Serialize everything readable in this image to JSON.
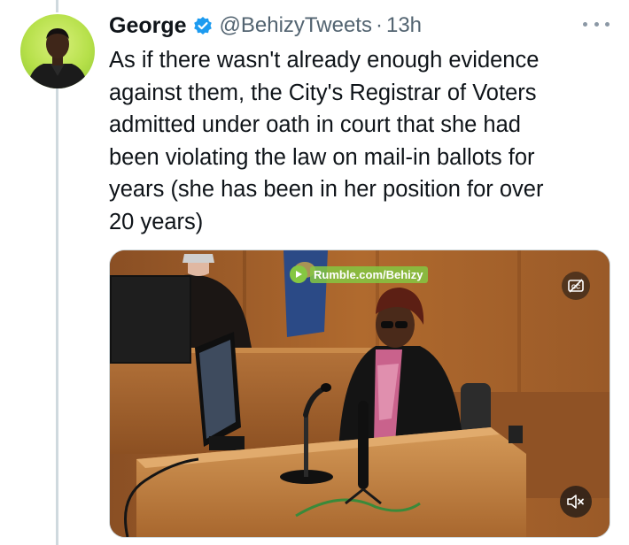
{
  "tweet": {
    "author": {
      "name": "George",
      "handle": "@BehizyTweets",
      "verified": true,
      "avatar": "profile-photo"
    },
    "separator": "·",
    "time": "13h",
    "more_icon": "more-horizontal-icon",
    "text_lines": [
      "As if there wasn't already enough evidence",
      "against them, the City's Registrar of Voters",
      "admitted under oath in court that she had",
      "been violating the law on mail-in ballots for",
      "years (she has been in her position for over",
      "20 years)"
    ],
    "media": {
      "type": "video",
      "watermark": "Rumble.com/Behizy",
      "captions_icon": "closed-captions-off-icon",
      "mute_icon": "volume-muted-icon"
    }
  },
  "colors": {
    "text_primary": "#0f1419",
    "text_secondary": "#536471",
    "verified": "#1d9bf0",
    "thread_line": "#cfd9de",
    "rumble_green": "#85c742"
  }
}
